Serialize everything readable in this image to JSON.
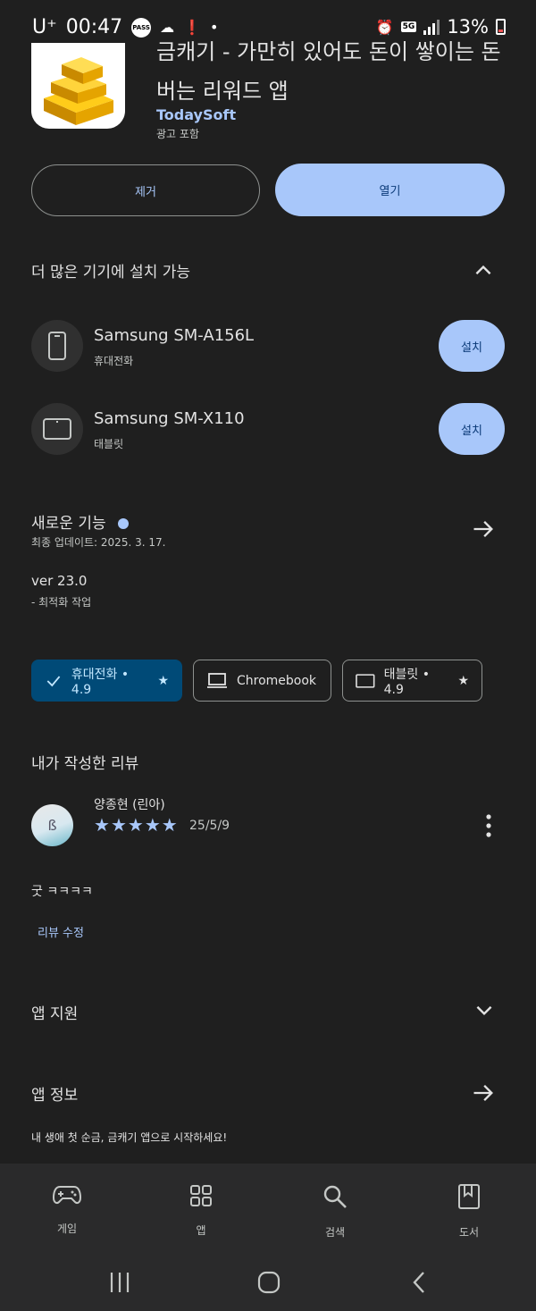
{
  "status_bar": {
    "carrier": "U⁺",
    "time": "00:47",
    "pass_badge": "PASS",
    "network": "5G",
    "battery": "13%"
  },
  "app": {
    "title": "금캐기 - 가만히 있어도 돈이 쌓이는 돈버는 리워드 앱",
    "developer": "TodaySoft",
    "ads_label": "광고 포함"
  },
  "actions": {
    "remove_label": "제거",
    "open_label": "열기"
  },
  "devices_section": {
    "title": "더 많은 기기에 설치 가능",
    "devices": [
      {
        "name": "Samsung SM-A156L",
        "type": "휴대전화",
        "install_label": "설치",
        "icon": "phone-icon"
      },
      {
        "name": "Samsung SM-X110",
        "type": "태블릿",
        "install_label": "설치",
        "icon": "tablet-icon"
      }
    ]
  },
  "whats_new": {
    "title": "새로운 기능",
    "last_updated": "최종 업데이트: 2025. 3. 17.",
    "version": "ver 23.0",
    "note": "- 최적화 작업"
  },
  "device_chips": [
    {
      "label": "휴대전화 • 4.9",
      "selected": true
    },
    {
      "label": "Chromebook",
      "selected": false
    },
    {
      "label": "태블릿 • 4.9",
      "selected": false
    }
  ],
  "my_review": {
    "title": "내가 작성한 리뷰",
    "reviewer": "양종현 (린아)",
    "stars": 5,
    "date": "25/5/9",
    "text": "굿 ㅋㅋㅋㅋ",
    "edit_label": "리뷰 수정"
  },
  "app_support": {
    "title": "앱 지원"
  },
  "app_info": {
    "title": "앱 정보",
    "description": "내 생애 첫 순금, 금캐기 앱으로 시작하세요!"
  },
  "bottom_nav": [
    {
      "label": "게임",
      "icon": "gamepad-icon"
    },
    {
      "label": "앱",
      "icon": "apps-grid-icon"
    },
    {
      "label": "검색",
      "icon": "search-icon"
    },
    {
      "label": "도서",
      "icon": "book-icon"
    }
  ],
  "colors": {
    "background": "#1f1f1f",
    "accent": "#a8c7fa",
    "chip_active": "#004a77"
  }
}
